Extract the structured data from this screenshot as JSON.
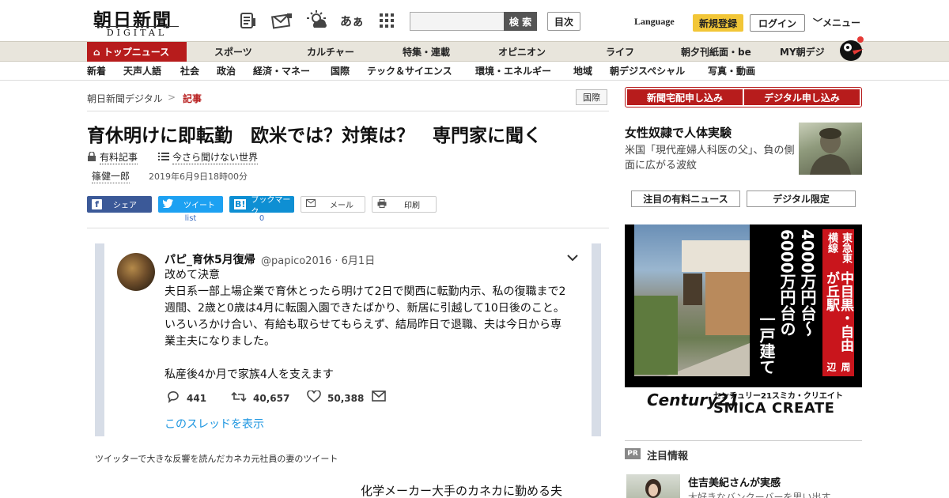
{
  "header": {
    "logo_main": "朝日新聞",
    "logo_sub": "DIGITAL",
    "icons": [
      "paper-icon",
      "mail-icon",
      "weather-icon",
      "font-size-icon",
      "grid-menu-icon"
    ],
    "font_icon_text": "あぁ",
    "search_placeholder": "",
    "search_button": "検 索",
    "toc_button": "目次",
    "language": "Language",
    "register": "新規登録",
    "login": "ログイン",
    "menu": "メニュー"
  },
  "nav_primary": [
    "トップニュース",
    "スポーツ",
    "カルチャー",
    "特集・連載",
    "オピニオン",
    "ライフ",
    "朝夕刊紙面・be",
    "MY朝デジ"
  ],
  "nav_secondary": [
    "新着",
    "天声人語",
    "社会",
    "政治",
    "経済・マネー",
    "国際",
    "テック＆サイエンス",
    "環境・エネルギー",
    "地域",
    "朝デジスペシャル",
    "写真・動画"
  ],
  "breadcrumb": {
    "home": "朝日新聞デジタル",
    "sep": ">",
    "current": "記事"
  },
  "region_tag": "国際",
  "article": {
    "headline": "育休明けに即転勤　欧米では？対策は？　専門家に聞く",
    "paid_label": "有料記事",
    "series_label": "今さら聞けない世界",
    "author": "篠健一郎",
    "date": "2019年6月9日18時00分",
    "caption": "ツイッターで大きな反響を読んだカネカ元社員の妻のツイート",
    "body_start": "化学メーカー大手のカネカに勤める夫"
  },
  "share": {
    "facebook": "シェア",
    "twitter": "ツイート",
    "hatena": "ブックマーク",
    "hatena_badge": "B!",
    "mail": "メール",
    "print": "印刷",
    "twitter_count": "list",
    "hatena_count": "0"
  },
  "tweet": {
    "name": "パピ_育休5月復帰",
    "handle": "@papico2016 · 6月1日",
    "lines": [
      "改めて決意",
      "夫日系一部上場企業で育休とったら明けて2日で関西に転勤内示、私の復職まで2",
      "週間、2歳と0歳は4月に転園入園できたばかり、新居に引越して10日後のこと。",
      "いろいろかけ合い、有給も取らせてもらえず、結局昨日で退職、夫は今日から専",
      "業主夫になりました。",
      "",
      "私産後4か月で家族4人を支えます"
    ],
    "replies": "441",
    "retweets": "40,657",
    "likes": "50,388",
    "thread_link": "このスレッドを表示"
  },
  "sidebar": {
    "subscribe_print": "新聞宅配申し込み",
    "subscribe_digital": "デジタル申し込み",
    "featured_title": "女性奴隷で人体実験",
    "featured_desc": "米国「現代産婦人科医の父」、負の側面に広がる波紋",
    "tab_paid": "注目の有料ニュース",
    "tab_digital": "デジタル限定",
    "pr_tag": "PR",
    "pr_heading": "注目情報",
    "pr_item_title": "住吉美紀さんが実感",
    "pr_item_sub": "大好きなバンクーバーを思い出す"
  },
  "ad": {
    "line_tag": "東急東横線",
    "station": "中目黒・自由が丘駅",
    "area": "周辺",
    "price1": "4000万円台～",
    "price2": "6000万円台の",
    "type": "一戸建て",
    "brand_left": "Century21",
    "brand_small": "センチュリー21スミカ・クリエイト",
    "brand_big": "SMICA CREATE"
  },
  "colors": {
    "accent": "#b71c1c",
    "register": "#f2c637",
    "facebook": "#3b5998",
    "twitter": "#1da1f2",
    "hatena": "#0e8fd3",
    "link": "#1b95e0"
  }
}
